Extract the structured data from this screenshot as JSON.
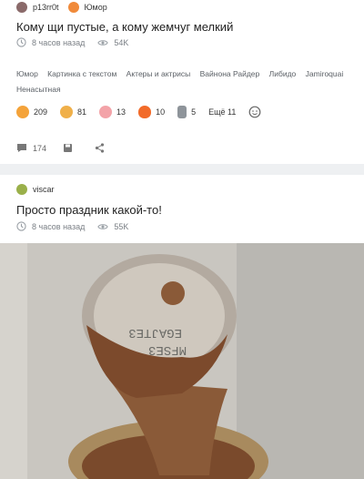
{
  "post1": {
    "author": "p13rr0t",
    "community": "Юмор",
    "title": "Кому щи пустые, а кому жемчуг мелкий",
    "time": "8 часов назад",
    "views": "54K",
    "tags": [
      "Юмор",
      "Картинка с текстом",
      "Актеры и актрисы",
      "Вайнона Райдер",
      "Либидо",
      "Jamiroquai",
      "Ненасытная"
    ],
    "reactions": [
      {
        "icon": "laughing-emoji-icon",
        "count": "209",
        "color": "#f4a33a"
      },
      {
        "icon": "grinning-emoji-icon",
        "count": "81",
        "color": "#f0b04a"
      },
      {
        "icon": "pig-emoji-icon",
        "count": "13",
        "color": "#f3a3a8"
      },
      {
        "icon": "fire-emoji-icon",
        "count": "10",
        "color": "#f26b2a"
      },
      {
        "icon": "moai-emoji-icon",
        "count": "5",
        "color": "#9aa0a6"
      }
    ],
    "more_reactions": "Ещё 11",
    "comments": "174"
  },
  "post2": {
    "author": "viscar",
    "title": "Просто праздник какой-то!",
    "time": "8 часов назад",
    "views": "55K"
  },
  "colors": {
    "meta_gray": "#7a7f85",
    "background": "#eef0f2"
  }
}
